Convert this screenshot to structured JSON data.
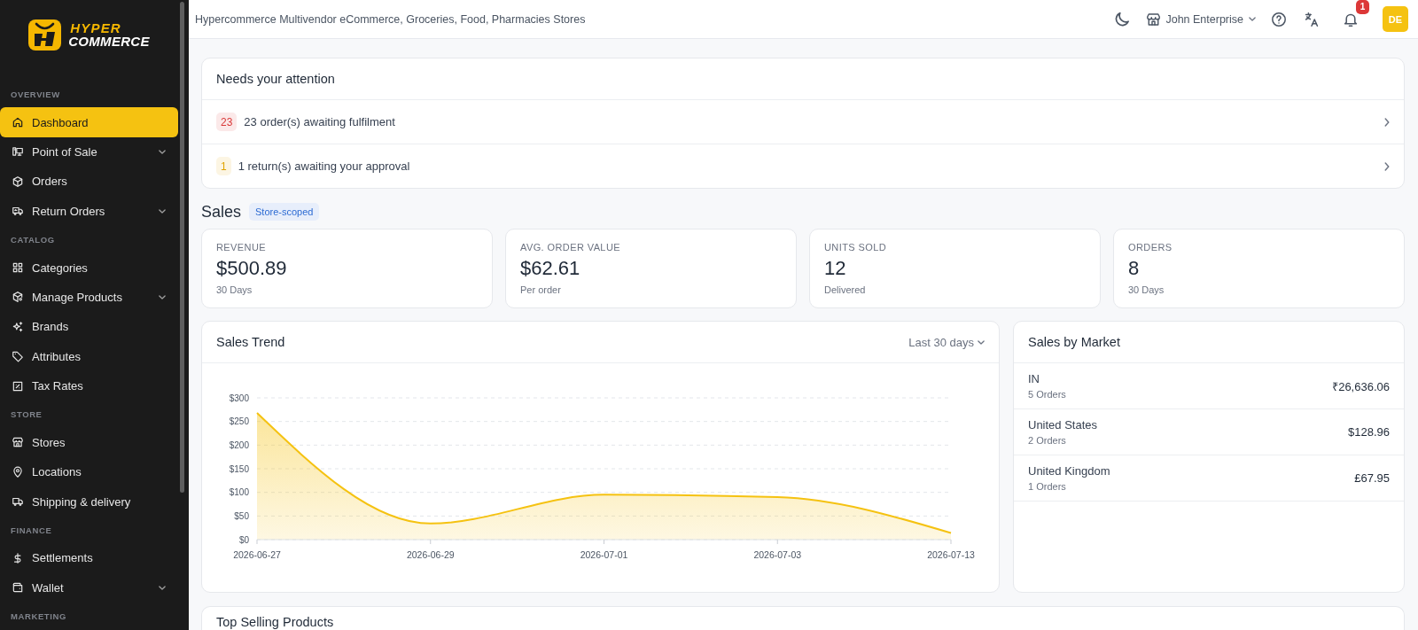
{
  "logo": {
    "line_1": "HYPER",
    "line_2": "COMMERCE"
  },
  "sidebar": {
    "sections": [
      {
        "title": "OVERVIEW",
        "items": [
          {
            "label": "Dashboard",
            "kind": "link",
            "selected": true
          },
          {
            "label": "Point of Sale",
            "kind": "submenu",
            "selected": false
          },
          {
            "label": "Orders",
            "kind": "link",
            "selected": false
          },
          {
            "label": "Return Orders",
            "kind": "submenu",
            "selected": false
          }
        ]
      },
      {
        "title": "CATALOG",
        "items": [
          {
            "label": "Categories",
            "kind": "link",
            "selected": false
          },
          {
            "label": "Manage Products",
            "kind": "submenu",
            "selected": false
          },
          {
            "label": "Brands",
            "kind": "link",
            "selected": false
          },
          {
            "label": "Attributes",
            "kind": "link",
            "selected": false
          },
          {
            "label": "Tax Rates",
            "kind": "link",
            "selected": false
          }
        ]
      },
      {
        "title": "STORE",
        "items": [
          {
            "label": "Stores",
            "kind": "link",
            "selected": false
          },
          {
            "label": "Locations",
            "kind": "link",
            "selected": false
          },
          {
            "label": "Shipping & delivery",
            "kind": "link",
            "selected": false
          }
        ]
      },
      {
        "title": "FINANCE",
        "items": [
          {
            "label": "Settlements",
            "kind": "link",
            "selected": false
          },
          {
            "label": "Wallet",
            "kind": "submenu",
            "selected": false
          }
        ]
      },
      {
        "title": "MARKETING"
      }
    ]
  },
  "top_bar": {
    "title": "Hypercommerce Multivendor eCommerce, Groceries, Food, Pharmacies Stores",
    "store": "John Enterprise",
    "notification_count": "1",
    "avatar": "DE"
  },
  "attention": {
    "title": "Needs your attention",
    "items": [
      {
        "count": "23",
        "text": "23 order(s) awaiting fulfilment",
        "color": "#d93a3a"
      },
      {
        "count": "1",
        "text": "1 return(s) awaiting your approval",
        "color": "#e0a300"
      }
    ]
  },
  "sales": {
    "title": "Sales",
    "badge": "Store-scoped",
    "metrics": [
      {
        "label": "REVENUE",
        "value": "$500.89",
        "note": "30 Days"
      },
      {
        "label": "AVG. ORDER VALUE",
        "value": "$62.61",
        "note": "Per order"
      },
      {
        "label": "UNITS SOLD",
        "value": "12",
        "note": "Delivered"
      },
      {
        "label": "ORDERS",
        "value": "8",
        "note": "30 Days"
      }
    ]
  },
  "sales_trend": {
    "title": "Sales Trend",
    "period": "Last 30 days",
    "chart_data": {
      "type": "area",
      "categories": [
        "2026-06-27",
        "2026-06-29",
        "2026-07-01",
        "2026-07-03",
        "2026-07-13"
      ],
      "series": [
        {
          "color": "#f5c211",
          "values": [
            268,
            34,
            95,
            90,
            14
          ]
        }
      ],
      "ylim": [
        0,
        300
      ],
      "yticks": [
        {
          "value": 0,
          "label": "$0"
        },
        {
          "value": 50,
          "label": "$50"
        },
        {
          "value": 100,
          "label": "$100"
        },
        {
          "value": 150,
          "label": "$150"
        },
        {
          "value": 200,
          "label": "$200"
        },
        {
          "value": 250,
          "label": "$250"
        },
        {
          "value": 300,
          "label": "$300"
        }
      ],
      "grid": true
    }
  },
  "sales_by_market": {
    "title": "Sales by Market",
    "rows": [
      {
        "market": "IN",
        "orders": "5 Orders",
        "amount": "₹26,636.06"
      },
      {
        "market": "United States",
        "orders": "2 Orders",
        "amount": "$128.96"
      },
      {
        "market": "United Kingdom",
        "orders": "1 Orders",
        "amount": "£67.95"
      }
    ]
  },
  "top_selling_products": {
    "title": "Top Selling Products"
  }
}
